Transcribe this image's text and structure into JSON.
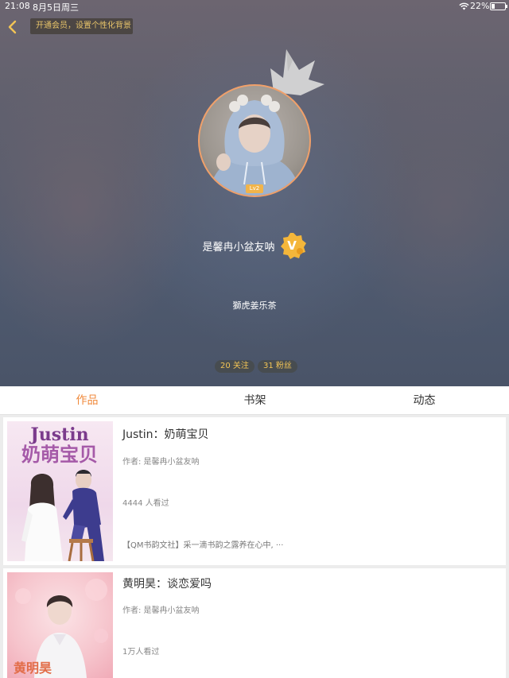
{
  "status_bar": {
    "time": "21:08",
    "date": "8月5日周三",
    "battery": "22%"
  },
  "header": {
    "vip_banner": "开通会员，设置个性化背景",
    "back_icon": "chevron-left-icon"
  },
  "profile": {
    "level": "Lv2",
    "username": "是馨冉小盆友呐",
    "verified_badge": "V",
    "signature": "獅虎姜乐茶",
    "follow": "20 关注",
    "fans": "31 粉丝"
  },
  "tabs": [
    {
      "label": "作品",
      "active": true
    },
    {
      "label": "书架",
      "active": false
    },
    {
      "label": "动态",
      "active": false
    }
  ],
  "books": [
    {
      "title": "Justin：奶萌宝贝",
      "author": "作者: 是馨冉小盆友呐",
      "views": "4444 人看过",
      "desc": "【QM书韵文社】采一滴书韵之露养在心中, ···",
      "cover_title_line1": "Justin",
      "cover_title_line2": "奶萌宝贝"
    },
    {
      "title": "黄明昊：谈恋爱吗",
      "author": "作者: 是馨冉小盆友呐",
      "views": "1万人看过",
      "cover_title_line1": "黄明昊"
    }
  ],
  "colors": {
    "accent": "#f08a3c",
    "stat_text": "#f2c455",
    "vip_text": "#e8c46a",
    "level_badge": "#f1b44a"
  }
}
